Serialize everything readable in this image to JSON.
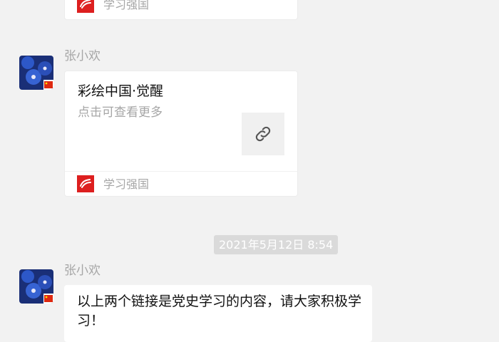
{
  "messages": [
    {
      "type": "link_card_partial",
      "app_name": "学习强国"
    },
    {
      "type": "link_card",
      "sender": "张小欢",
      "title": "彩绘中国·觉醒",
      "description": "点击可查看更多",
      "thumb_icon": "link-icon",
      "app_name": "学习强国"
    },
    {
      "type": "timestamp",
      "text": "2021年5月12日 8:54"
    },
    {
      "type": "text",
      "sender": "张小欢",
      "text": "以上两个链接是党史学习的内容，请大家积极学习！"
    }
  ],
  "colors": {
    "background": "#f2f2f2",
    "card": "#ffffff",
    "app_logo": "#dd1f1f",
    "muted_text": "#a6a6a6",
    "timestamp_bg": "#dadada"
  }
}
